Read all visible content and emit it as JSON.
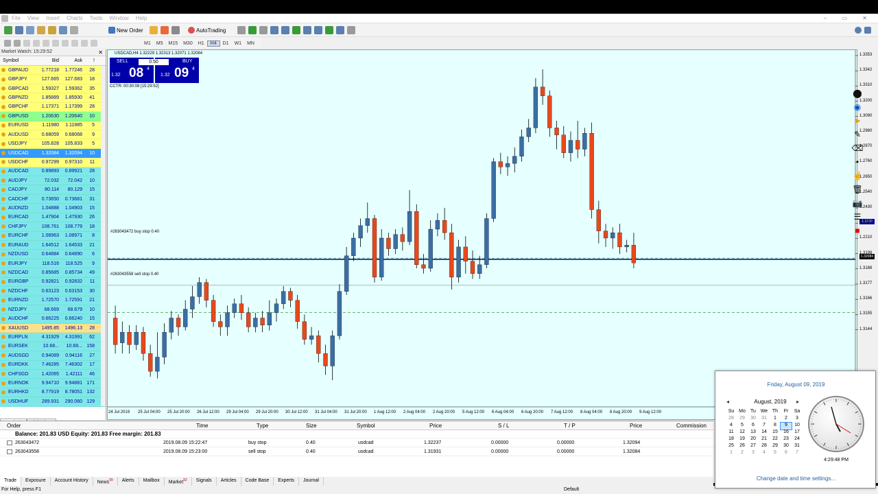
{
  "menu": [
    "File",
    "View",
    "Insert",
    "Charts",
    "Tools",
    "Window",
    "Help"
  ],
  "toolbar": {
    "new_order": "New Order",
    "auto_trading": "AutoTrading"
  },
  "timeframes": [
    "M1",
    "M5",
    "M15",
    "M30",
    "H1",
    "H4",
    "D1",
    "W1",
    "MN"
  ],
  "market_watch": {
    "title": "Market Watch: 15:29:52",
    "col_symbol": "Symbol",
    "col_bid": "Bid",
    "col_ask": "Ask",
    "col_spread": "!",
    "rows": [
      {
        "s": "GBPAUD",
        "b": "1.77218",
        "a": "1.77246",
        "p": "28",
        "c": "y"
      },
      {
        "s": "GBPJPY",
        "b": "127.665",
        "a": "127.683",
        "p": "18",
        "c": "y"
      },
      {
        "s": "GBPCAD",
        "b": "1.59327",
        "a": "1.59362",
        "p": "35",
        "c": "y"
      },
      {
        "s": "GBPNZD",
        "b": "1.85889",
        "a": "1.85930",
        "p": "41",
        "c": "y"
      },
      {
        "s": "GBPCHF",
        "b": "1.17371",
        "a": "1.17399",
        "p": "28",
        "c": "y"
      },
      {
        "s": "GBPUSD",
        "b": "1.20630",
        "a": "1.20640",
        "p": "10",
        "c": "g"
      },
      {
        "s": "EURUSD",
        "b": "1.11980",
        "a": "1.11985",
        "p": "5",
        "c": "y"
      },
      {
        "s": "AUDUSD",
        "b": "0.68059",
        "a": "0.68068",
        "p": "9",
        "c": "y"
      },
      {
        "s": "USDJPY",
        "b": "105.828",
        "a": "105.833",
        "p": "5",
        "c": "y"
      },
      {
        "s": "USDCAD",
        "b": "1.32084",
        "a": "1.32094",
        "p": "10",
        "c": "s"
      },
      {
        "s": "USDCHF",
        "b": "0.97299",
        "a": "0.97310",
        "p": "11",
        "c": "y"
      },
      {
        "s": "AUDCAD",
        "b": "0.89893",
        "a": "0.89921",
        "p": "28",
        "c": "t"
      },
      {
        "s": "AUDJPY",
        "b": "72.032",
        "a": "72.042",
        "p": "10",
        "c": "t"
      },
      {
        "s": "CADJPY",
        "b": "80.114",
        "a": "80.129",
        "p": "15",
        "c": "t"
      },
      {
        "s": "CADCHF",
        "b": "0.73650",
        "a": "0.73681",
        "p": "31",
        "c": "t"
      },
      {
        "s": "AUDNZD",
        "b": "1.04888",
        "a": "1.04903",
        "p": "15",
        "c": "t"
      },
      {
        "s": "EURCAD",
        "b": "1.47904",
        "a": "1.47930",
        "p": "26",
        "c": "t"
      },
      {
        "s": "CHFJPY",
        "b": "108.761",
        "a": "108.779",
        "p": "18",
        "c": "t"
      },
      {
        "s": "EURCHF",
        "b": "1.08963",
        "a": "1.08971",
        "p": "8",
        "c": "t"
      },
      {
        "s": "EURAUD",
        "b": "1.64512",
        "a": "1.64533",
        "p": "21",
        "c": "t"
      },
      {
        "s": "NZDUSD",
        "b": "0.64884",
        "a": "0.64890",
        "p": "6",
        "c": "t"
      },
      {
        "s": "EURJPY",
        "b": "118.516",
        "a": "118.525",
        "p": "9",
        "c": "t"
      },
      {
        "s": "NZDCAD",
        "b": "0.85685",
        "a": "0.85734",
        "p": "49",
        "c": "t"
      },
      {
        "s": "EURGBP",
        "b": "0.92821",
        "a": "0.92832",
        "p": "11",
        "c": "t"
      },
      {
        "s": "NZDCHF",
        "b": "0.63123",
        "a": "0.63153",
        "p": "30",
        "c": "t"
      },
      {
        "s": "EURNZD",
        "b": "1.72570",
        "a": "1.72591",
        "p": "21",
        "c": "t"
      },
      {
        "s": "NZDJPY",
        "b": "68.669",
        "a": "68.679",
        "p": "10",
        "c": "t"
      },
      {
        "s": "AUDCHF",
        "b": "0.66225",
        "a": "0.66240",
        "p": "15",
        "c": "t"
      },
      {
        "s": "XAUUSD",
        "b": "1495.85",
        "a": "1496.13",
        "p": "28",
        "c": "o"
      },
      {
        "s": "EURPLN",
        "b": "4.31929",
        "a": "4.31991",
        "p": "62",
        "c": "t"
      },
      {
        "s": "EURSEK",
        "b": "10.68...",
        "a": "10.69...",
        "p": "158",
        "c": "t"
      },
      {
        "s": "AUDSGD",
        "b": "0.94089",
        "a": "0.94116",
        "p": "27",
        "c": "t"
      },
      {
        "s": "EURDKK",
        "b": "7.46285",
        "a": "7.46302",
        "p": "17",
        "c": "t"
      },
      {
        "s": "CHFSGD",
        "b": "1.42065",
        "a": "1.42111",
        "p": "46",
        "c": "t"
      },
      {
        "s": "EURNOK",
        "b": "9.94710",
        "a": "9.94881",
        "p": "171",
        "c": "t"
      },
      {
        "s": "EURHKD",
        "b": "8.77919",
        "a": "8.78051",
        "p": "132",
        "c": "t"
      },
      {
        "s": "USDHUF",
        "b": "289.931",
        "a": "290.060",
        "p": "129",
        "c": "t"
      }
    ],
    "tabs": [
      "Symbols",
      "Tick Chart"
    ]
  },
  "chart": {
    "label": "USDCAD,H4  1.32229 1.32313 1.32071 1.32084",
    "sell": "SELL",
    "buy": "BUY",
    "lot": "0.50",
    "sell_prefix": "1.32",
    "sell_big": "08",
    "sell_sup": "4",
    "buy_prefix": "1.32",
    "buy_big": "09",
    "buy_sup": "4",
    "cctr": "CCTR: 00:30:08 [15:29:52]",
    "order1": "#263043472 buy stop 0.40",
    "order2": "#263043558 sell stop 0.40",
    "price_tag_1": "1.3239",
    "price_tag_2": "1.32084"
  },
  "chart_data": {
    "type": "candlestick",
    "x_ticks": [
      "24 Jul 2019",
      "25 Jul 04:00",
      "25 Jul 20:00",
      "26 Jul 12:00",
      "29 Jul 04:00",
      "29 Jul 20:00",
      "30 Jul 12:00",
      "31 Jul 04:00",
      "31 Jul 20:00",
      "1 Aug 12:00",
      "2 Aug 04:00",
      "2 Aug 20:00",
      "5 Aug 12:00",
      "6 Aug 04:00",
      "6 Aug 20:00",
      "7 Aug 12:00",
      "8 Aug 04:00",
      "8 Aug 20:00",
      "9 Aug 12:00"
    ],
    "y_ticks": [
      "1.3353",
      "1.3342",
      "1.3310",
      "1.3200",
      "1.3090",
      "1.2980",
      "1.2870",
      "1.2760",
      "1.2650",
      "1.2540",
      "1.2430",
      "1.2320",
      "1.2210",
      "1.3199",
      "1.3188",
      "1.3177",
      "1.3166",
      "1.3155",
      "1.3144"
    ],
    "candles": [
      [
        1.319,
        1.3175,
        1.3197,
        1.317
      ],
      [
        1.3176,
        1.3182,
        1.3188,
        1.317
      ],
      [
        1.3182,
        1.3175,
        1.3186,
        1.317
      ],
      [
        1.3175,
        1.3182,
        1.3186,
        1.3172
      ],
      [
        1.3182,
        1.317,
        1.3185,
        1.3166
      ],
      [
        1.317,
        1.316,
        1.3175,
        1.3157
      ],
      [
        1.316,
        1.3168,
        1.3182,
        1.3156
      ],
      [
        1.3168,
        1.3182,
        1.3187,
        1.3164
      ],
      [
        1.3182,
        1.319,
        1.3194,
        1.3178
      ],
      [
        1.319,
        1.3185,
        1.3192,
        1.318
      ],
      [
        1.3185,
        1.3195,
        1.32,
        1.3183
      ],
      [
        1.3195,
        1.3202,
        1.3208,
        1.319
      ],
      [
        1.3202,
        1.321,
        1.3213,
        1.3198
      ],
      [
        1.321,
        1.32,
        1.3212,
        1.3196
      ],
      [
        1.32,
        1.3188,
        1.3203,
        1.3185
      ],
      [
        1.3188,
        1.3185,
        1.3192,
        1.318
      ],
      [
        1.3185,
        1.3193,
        1.3197,
        1.318
      ],
      [
        1.3193,
        1.3198,
        1.3201,
        1.319
      ],
      [
        1.3198,
        1.3193,
        1.3203,
        1.3189
      ],
      [
        1.3193,
        1.3185,
        1.3196,
        1.3182
      ],
      [
        1.3185,
        1.319,
        1.3193,
        1.3182
      ],
      [
        1.319,
        1.3186,
        1.3194,
        1.3182
      ],
      [
        1.3186,
        1.3193,
        1.32,
        1.3183
      ],
      [
        1.3193,
        1.3198,
        1.3201,
        1.3188
      ],
      [
        1.3198,
        1.3205,
        1.3208,
        1.3195
      ],
      [
        1.3205,
        1.32,
        1.3207,
        1.3196
      ],
      [
        1.32,
        1.3188,
        1.3203,
        1.3184
      ],
      [
        1.3188,
        1.3178,
        1.3192,
        1.3175
      ],
      [
        1.3178,
        1.318,
        1.3185,
        1.3175
      ],
      [
        1.318,
        1.317,
        1.3183,
        1.3165
      ],
      [
        1.317,
        1.3163,
        1.3175,
        1.3158
      ],
      [
        1.3163,
        1.318,
        1.3183,
        1.3155
      ],
      [
        1.318,
        1.3205,
        1.3209,
        1.3178
      ],
      [
        1.3205,
        1.3225,
        1.323,
        1.3203
      ],
      [
        1.3225,
        1.3235,
        1.3238,
        1.3222
      ],
      [
        1.3235,
        1.3242,
        1.3246,
        1.323
      ],
      [
        1.3242,
        1.3246,
        1.3255,
        1.3238
      ],
      [
        1.3246,
        1.3213,
        1.3248,
        1.321
      ],
      [
        1.3213,
        1.3235,
        1.324,
        1.3211
      ],
      [
        1.3235,
        1.3229,
        1.3238,
        1.3225
      ],
      [
        1.3229,
        1.3237,
        1.324,
        1.3226
      ],
      [
        1.3237,
        1.3233,
        1.3241,
        1.3228
      ],
      [
        1.3233,
        1.325,
        1.3262,
        1.3231
      ],
      [
        1.325,
        1.322,
        1.3254,
        1.3218
      ],
      [
        1.322,
        1.3218,
        1.3226,
        1.3215
      ],
      [
        1.3218,
        1.324,
        1.3245,
        1.3216
      ],
      [
        1.324,
        1.3245,
        1.3249,
        1.3236
      ],
      [
        1.3245,
        1.3238,
        1.3252,
        1.3234
      ],
      [
        1.3238,
        1.3213,
        1.3243,
        1.3206
      ],
      [
        1.3213,
        1.323,
        1.3234,
        1.321
      ],
      [
        1.323,
        1.3222,
        1.3236,
        1.3215
      ],
      [
        1.3222,
        1.3215,
        1.3228,
        1.3212
      ],
      [
        1.3215,
        1.322,
        1.3225,
        1.3212
      ],
      [
        1.322,
        1.3246,
        1.3249,
        1.3218
      ],
      [
        1.3246,
        1.3278,
        1.328,
        1.3244
      ],
      [
        1.3278,
        1.3275,
        1.3283,
        1.3271
      ],
      [
        1.3275,
        1.3277,
        1.3281,
        1.327
      ],
      [
        1.3277,
        1.3281,
        1.3286,
        1.3272
      ],
      [
        1.3281,
        1.3292,
        1.3296,
        1.3278
      ],
      [
        1.3292,
        1.3297,
        1.3302,
        1.3289
      ],
      [
        1.3297,
        1.332,
        1.3325,
        1.3294
      ],
      [
        1.332,
        1.3315,
        1.333,
        1.331
      ],
      [
        1.3315,
        1.3297,
        1.3318,
        1.3292
      ],
      [
        1.3297,
        1.3293,
        1.3301,
        1.3285
      ],
      [
        1.3293,
        1.3283,
        1.3298,
        1.328
      ],
      [
        1.3283,
        1.329,
        1.3295,
        1.3278
      ],
      [
        1.329,
        1.3285,
        1.3301,
        1.328
      ],
      [
        1.3285,
        1.3294,
        1.3297,
        1.3281
      ],
      [
        1.3294,
        1.3251,
        1.33,
        1.3246
      ],
      [
        1.3251,
        1.3239,
        1.3256,
        1.3232
      ],
      [
        1.3239,
        1.3235,
        1.3243,
        1.323
      ],
      [
        1.3235,
        1.3238,
        1.3241,
        1.3229
      ],
      [
        1.3238,
        1.323,
        1.3243,
        1.3226
      ],
      [
        1.323,
        1.3231,
        1.3234,
        1.3227
      ],
      [
        1.3231,
        1.3221,
        1.3238,
        1.3218
      ]
    ]
  },
  "terminal": {
    "cols": [
      "Order",
      "Time",
      "Type",
      "Size",
      "Symbol",
      "Price",
      "S / L",
      "T / P",
      "Price",
      "Commission"
    ],
    "balance": "Balance: 201.83 USD  Equity: 201.83  Free margin: 201.83",
    "rows": [
      {
        "order": "263043472",
        "time": "2019.08.09 15:22:47",
        "type": "buy stop",
        "size": "0.40",
        "symbol": "usdcad",
        "price": "1.32237",
        "sl": "0.00000",
        "tp": "0.00000",
        "cur": "1.32094"
      },
      {
        "order": "263043558",
        "time": "2019.08.09 15:23:00",
        "type": "sell stop",
        "size": "0.40",
        "symbol": "usdcad",
        "price": "1.31931",
        "sl": "0.00000",
        "tp": "0.00000",
        "cur": "1.32084"
      }
    ],
    "tabs": [
      "Trade",
      "Exposure",
      "Account History",
      "News",
      "Alerts",
      "Mailbox",
      "Market",
      "Signals",
      "Articles",
      "Code Base",
      "Experts",
      "Journal"
    ],
    "news_badge": "99",
    "market_badge": "92"
  },
  "status": {
    "help": "For Help, press F1",
    "profile": "Default"
  },
  "calendar": {
    "date": "Friday, August 09, 2019",
    "month": "August, 2019",
    "dow": [
      "Su",
      "Mo",
      "Tu",
      "We",
      "Th",
      "Fr",
      "Sa"
    ],
    "weeks": [
      [
        "28",
        "29",
        "30",
        "31",
        "1",
        "2",
        "3"
      ],
      [
        "4",
        "5",
        "6",
        "7",
        "8",
        "9",
        "10"
      ],
      [
        "11",
        "12",
        "13",
        "14",
        "15",
        "16",
        "17"
      ],
      [
        "18",
        "19",
        "20",
        "21",
        "22",
        "23",
        "24"
      ],
      [
        "25",
        "26",
        "27",
        "28",
        "29",
        "30",
        "31"
      ],
      [
        "1",
        "2",
        "3",
        "4",
        "5",
        "6",
        "7"
      ]
    ],
    "time": "4:29:48 PM",
    "link": "Change date and time settings..."
  },
  "colors": {
    "bull": "#3a6ea5",
    "bear": "#e8481c",
    "chart_bg": "#e6ffff",
    "accent": "#0000aa"
  }
}
